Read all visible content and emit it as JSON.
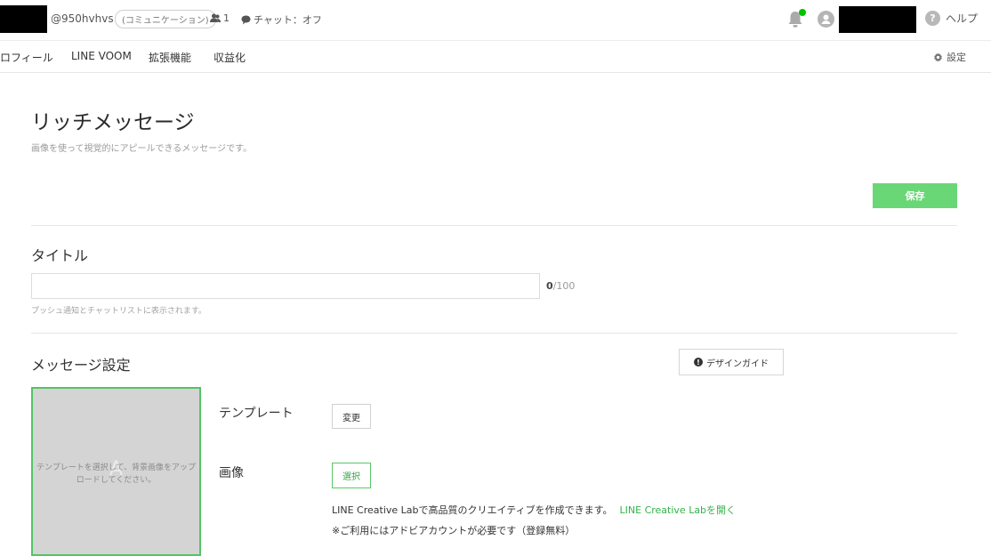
{
  "header": {
    "account_id": "@950hvhvs",
    "category": "(コミュニケーション)",
    "friends_count": "1",
    "chat_status": "チャット：オフ",
    "help_label": "ヘルプ"
  },
  "nav": {
    "items": [
      "プロフィール",
      "LINE VOOM",
      "拡張機能",
      "収益化"
    ],
    "settings_label": "設定"
  },
  "page": {
    "title": "リッチメッセージ",
    "description": "画像を使って視覚的にアピールできるメッセージです。",
    "save_label": "保存"
  },
  "title_section": {
    "label": "タイトル",
    "input_value": "",
    "char_count": "0",
    "char_max": "/100",
    "help": "プッシュ通知とチャットリストに表示されます。"
  },
  "message_settings": {
    "label": "メッセージ設定",
    "design_guide_label": "デザインガイド",
    "preview_letter": "A",
    "preview_hint": "テンプレートを選択して、背景画像をアップロードしてください。",
    "template_label": "テンプレート",
    "change_label": "変更",
    "image_label": "画像",
    "select_label": "選択",
    "creative_text": "LINE Creative Labで高品質のクリエイティブを作成できます。",
    "creative_link": "LINE Creative Labを開く",
    "creative_note": "※ご利用にはアドビアカウントが必要です（登録無料）"
  },
  "colors": {
    "accent_green": "#6ad776",
    "link_green": "#33b34a",
    "notification_dot": "#00c300"
  }
}
